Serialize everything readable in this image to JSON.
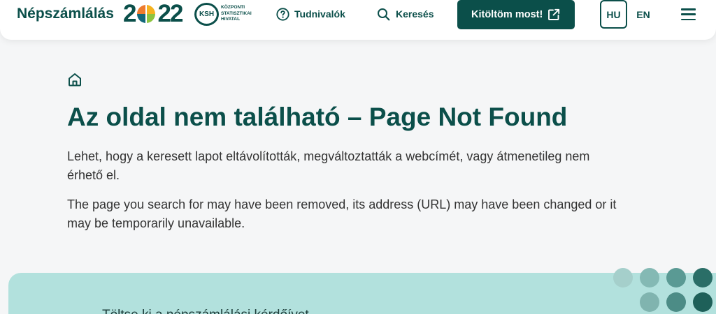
{
  "theme": {
    "primary": "#0b4f4a",
    "background": "#f5f6f7",
    "panel": "#b2e1dd",
    "text": "#333333"
  },
  "header": {
    "logo": {
      "brand": "Népszámlálás",
      "year": "2022",
      "ksh_abbr": "KSH",
      "ksh_lines": [
        "KÖZPONTI",
        "STATISZTIKAI",
        "HIVATAL"
      ]
    },
    "nav": [
      {
        "label": "Tudnivalók",
        "icon": "question-circle-icon"
      },
      {
        "label": "Keresés",
        "icon": "search-icon"
      }
    ],
    "cta_button": {
      "label": "Kitöltöm most!",
      "icon": "external-link-icon"
    },
    "languages": [
      {
        "code": "HU",
        "active": true
      },
      {
        "code": "EN",
        "active": false
      }
    ],
    "menu_icon": "hamburger-menu-icon"
  },
  "breadcrumb": {
    "home_icon": "home-icon"
  },
  "main": {
    "title": "Az oldal nem található – Page Not Found",
    "paragraphs": [
      "Lehet, hogy a keresett lapot eltávolították, megváltoztatták a webcímét, vagy átmenetileg nem érhető el.",
      "The page you search for may have been removed, its address (URL) may have been changed or it may be temporarily unavailable."
    ]
  },
  "cta_panel": {
    "heading": "Töltse ki a népszámlálási kérdőívet"
  }
}
